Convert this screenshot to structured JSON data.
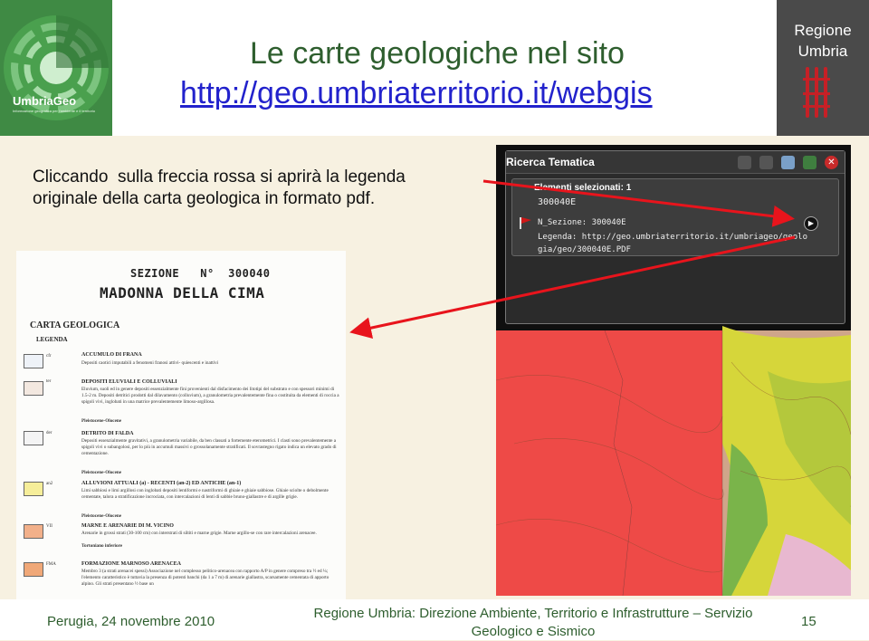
{
  "header": {
    "title": "Le carte geologiche nel sito",
    "link": "http://geo.umbriaterritorio.it/webgis",
    "logo_name": "UmbriaGeo",
    "logo_tagline": "Informazione geografica per l'ambiente e il territorio",
    "region_line1": "Regione",
    "region_line2": "Umbria"
  },
  "instruction": {
    "line1": "Cliccando  sulla freccia rossa si aprirà la legenda",
    "line2": "originale della carta geologica in formato pdf."
  },
  "legend_doc": {
    "section_label": "SEZIONE   N°  300040",
    "place": "MADONNA DELLA CIMA",
    "heading": "CARTA GEOLOGICA",
    "subheading": "LEGENDA",
    "entries": [
      {
        "code": "cfr",
        "title": "ACCUMULO DI FRANA",
        "desc": "Depositi caotici imputabili a fenomeni franosi attivi- quiescenti e inattivi",
        "age": ""
      },
      {
        "code": "ter",
        "title": "DEPOSITI ELUVIALI E COLLUVIALI",
        "desc": "Eluvium, suoli ed in genere depositi essenzialmente fini provenienti dal disfacimento dei litotipi del substrato e con spessori minimi di 1.5-2 m. Depositi detritici prodotti dal dilavamento (colluvium), a granulometria prevalentemente fina o costituita da elementi di roccia a spigoli vivi, inglobati in una matrice prevalentemente limoso-argillosa.",
        "age": "Pleistocene-Olocene"
      },
      {
        "code": "der",
        "title": "DETRITO DI FALDA",
        "desc": "Depositi essenzialmente gravitativi, a granulometria variabile, da ben classati a fortemente eterometrici. I clasti sono prevalentemente a spigoli vivi o subangolosi, per lo più in accumuli massivi o grossolanamente stratificati. Il sovrastegno rigato indica un elevato grado di cementazione.",
        "age": "Pleistocene-Olocene"
      },
      {
        "code": "an2",
        "title": "ALLUVIONI ATTUALI (a) - RECENTI (an-2) ED ANTICHE (an-1)",
        "desc": "Limi sabbiosi e limi argillosi con inglobati depositi lentiformi e nastriformi di ghiaie e ghiaie sabbiose. Ghiaie sciolte o debolmente cementate, talora a stratificazione incrociata, con intercalazioni di lenti di sabbie bruno-giallastre e di argille grigie.",
        "age": "Pleistocene-Olocene"
      },
      {
        "code": "VII",
        "title": "MARNE E ARENARIE DI M. VICINO",
        "desc": "Arenarie in grossi strati (30-100 cm) con interstrati di siltiti e marne grigie. Marne argillo-se con rare intercalazioni arenacee.",
        "age": "Tortoniano inferiore"
      },
      {
        "code": "FMA",
        "title": "FORMAZIONE MARNOSO ARENACEA",
        "desc": "Membro 3 (a strati arenacei spessi) Associazione nel complesso pelitico-arenacea con rapporto A/P in genere compreso tra ½ ed ¼; l'elemento caratteristico è tuttavia la presenza di potenti banchi (da 1 a 7 m) di arenarie giallastra, scarsamente cementata di apporto alpino. Gli strati presentano ½ base un",
        "age": ""
      }
    ]
  },
  "popup": {
    "title": "Ricerca Tematica",
    "selected_label": "Elementi selezionati: 1",
    "feature_id": "300040E",
    "sezione_line": "N_Sezione:   300040E",
    "legenda_line1": "Legenda: http://geo.umbriaterritorio.it/umbriageo/geolo",
    "legenda_line2": "gia/geo/300040E.PDF",
    "tools": [
      "query-tool-icon",
      "select-tool-icon",
      "table-icon",
      "export-icon",
      "close-icon"
    ]
  },
  "footer": {
    "date": "Perugia, 24 novembre 2010",
    "org_line1": "Regione Umbria: Direzione Ambiente, Territorio e Infrastrutture – Servizio",
    "org_line2": "Geologico e Sismico",
    "page": "15"
  },
  "colors": {
    "title_green": "#2e5e2e",
    "link_blue": "#2222cc",
    "arrow_red": "#e8141c",
    "selection_red": "#f03c3c"
  }
}
